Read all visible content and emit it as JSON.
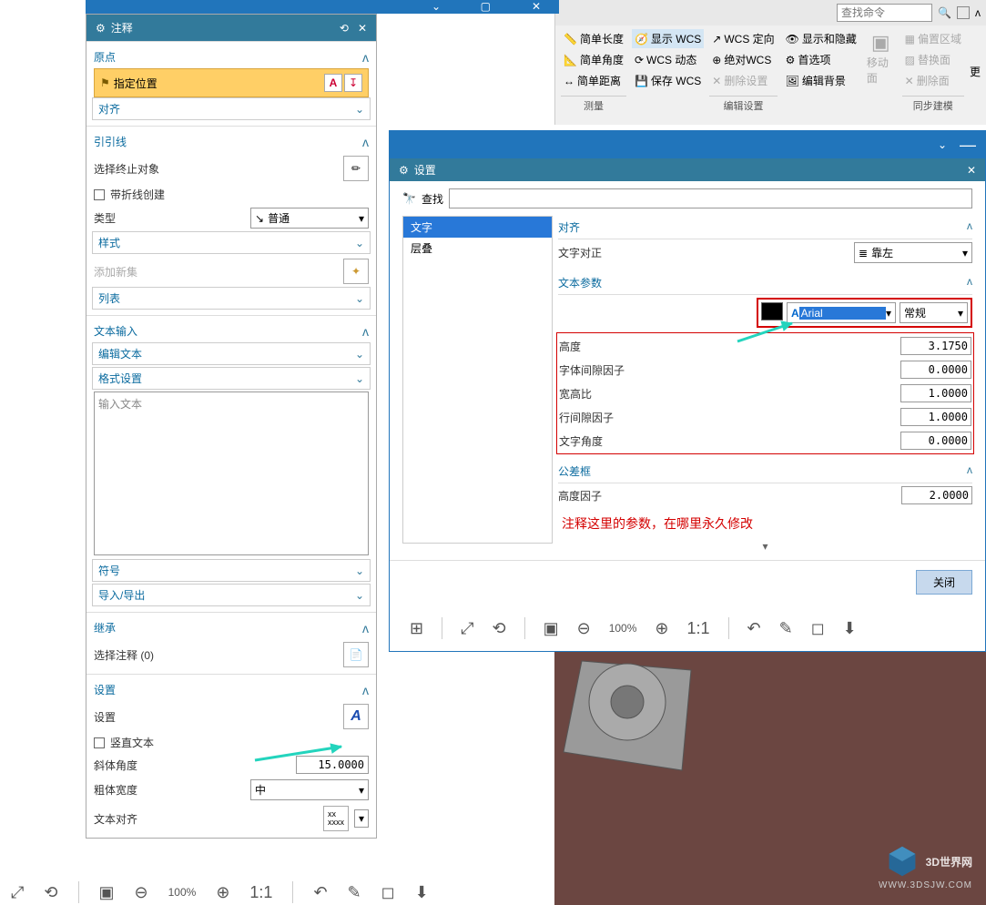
{
  "leftPanel": {
    "title": "注释",
    "origin": {
      "head": "原点",
      "specifyPos": "指定位置",
      "align": "对齐"
    },
    "guide": {
      "head": "引引线",
      "selectEnd": "选择终止对象",
      "createWithBreak": "带折线创建",
      "typeLabel": "类型",
      "typeValue": "普通",
      "style": "样式",
      "addNewSet": "添加新集",
      "list": "列表"
    },
    "textInput": {
      "head": "文本输入",
      "editText": "编辑文本",
      "format": "格式设置",
      "placeholder": "输入文本",
      "symbol": "符号",
      "importExport": "导入/导出"
    },
    "inherit": {
      "head": "继承",
      "selectNote": "选择注释 (0)"
    },
    "settings": {
      "head": "设置",
      "settingsLabel": "设置",
      "vertical": "竖直文本",
      "italicAngle": "斜体角度",
      "italicVal": "15.0000",
      "boldWidth": "粗体宽度",
      "boldVal": "中",
      "textAlign": "文本对齐"
    }
  },
  "ribbon": {
    "searchPlaceholder": "查找命令",
    "col1": {
      "a": "简单长度",
      "b": "简单角度",
      "c": "简单距离",
      "group": "测量"
    },
    "col2": {
      "a": "显示 WCS",
      "b": "WCS 动态",
      "c": "保存 WCS"
    },
    "col3": {
      "a": "WCS 定向",
      "b": "绝对WCS",
      "c": "删除设置",
      "group": "编辑设置"
    },
    "col4": {
      "a": "显示和隐藏",
      "b": "首选项",
      "c": "编辑背景"
    },
    "col5": {
      "big": "移动面",
      "a": "偏置区域",
      "b": "替换面",
      "c": "删除面",
      "group": "同步建模"
    },
    "more": "更"
  },
  "settingsWindow": {
    "title": "设置",
    "findLabel": "查找",
    "tree": {
      "text": "文字",
      "layer": "层叠"
    },
    "align": {
      "head": "对齐",
      "justify": "文字对正",
      "justifyVal": "靠左"
    },
    "params": {
      "head": "文本参数",
      "font": "Arial",
      "style": "常规",
      "height": "高度",
      "heightVal": "3.1750",
      "gap": "字体间隙因子",
      "gapVal": "0.0000",
      "aspect": "宽高比",
      "aspectVal": "1.0000",
      "lineGap": "行间隙因子",
      "lineGapVal": "1.0000",
      "angle": "文字角度",
      "angleVal": "0.0000"
    },
    "tol": {
      "head": "公差框",
      "heightFactor": "高度因子",
      "heightFactorVal": "2.0000"
    },
    "redNote": "注释这里的参数，在哪里永久修改",
    "close": "关闭"
  },
  "bottomToolbar": {
    "zoom": "100%"
  },
  "watermark": {
    "main": "3D世界网",
    "sub": "WWW.3DSJW.COM"
  }
}
